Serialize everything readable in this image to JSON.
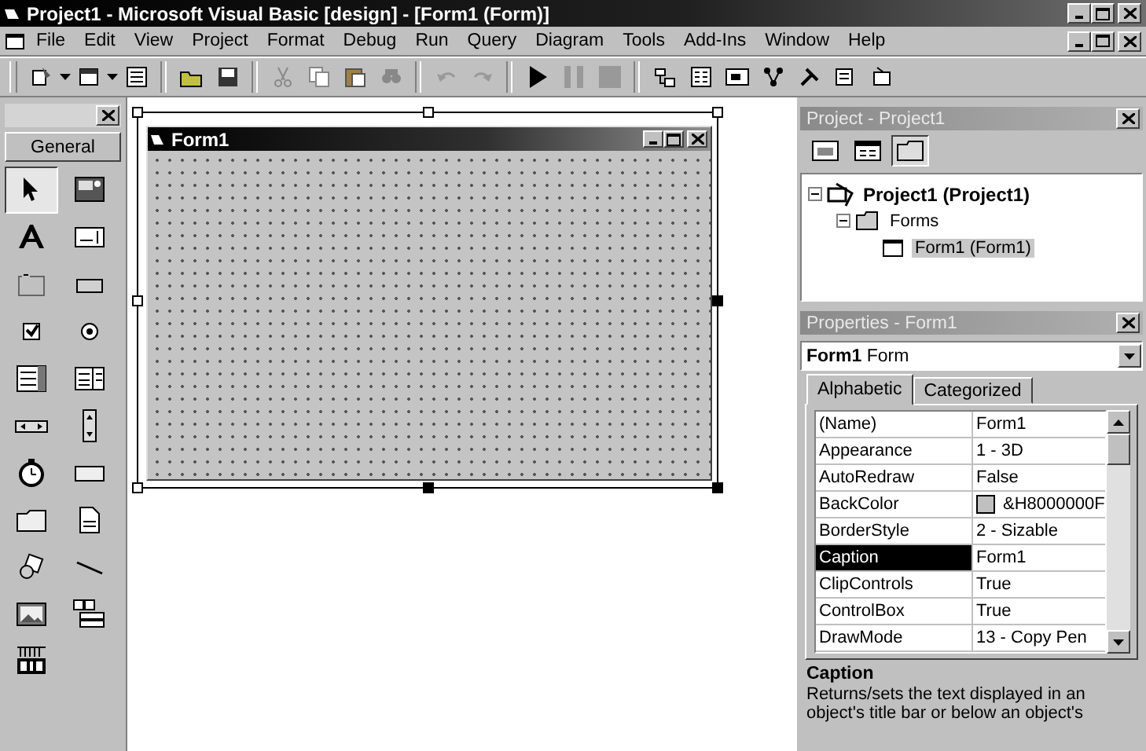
{
  "window": {
    "title": "Project1 - Microsoft Visual Basic [design] - [Form1 (Form)]"
  },
  "menu": [
    {
      "label": "File"
    },
    {
      "label": "Edit"
    },
    {
      "label": "View"
    },
    {
      "label": "Project"
    },
    {
      "label": "Format"
    },
    {
      "label": "Debug"
    },
    {
      "label": "Run"
    },
    {
      "label": "Query"
    },
    {
      "label": "Diagram"
    },
    {
      "label": "Tools"
    },
    {
      "label": "Add-Ins"
    },
    {
      "label": "Window"
    },
    {
      "label": "Help"
    }
  ],
  "toolbox": {
    "tab": "General",
    "tools": [
      {
        "kind": "pointer",
        "selected": true
      },
      {
        "kind": "picturebox",
        "selected": false
      },
      {
        "kind": "label",
        "selected": false
      },
      {
        "kind": "textbox",
        "selected": false
      },
      {
        "kind": "frame",
        "selected": false
      },
      {
        "kind": "commandbutton",
        "selected": false
      },
      {
        "kind": "checkbox",
        "selected": false
      },
      {
        "kind": "optionbutton",
        "selected": false
      },
      {
        "kind": "combobox",
        "selected": false
      },
      {
        "kind": "listbox",
        "selected": false
      },
      {
        "kind": "hscroll",
        "selected": false
      },
      {
        "kind": "vscroll",
        "selected": false
      },
      {
        "kind": "timer",
        "selected": false
      },
      {
        "kind": "drivelist",
        "selected": false
      },
      {
        "kind": "dirlist",
        "selected": false
      },
      {
        "kind": "filelist",
        "selected": false
      },
      {
        "kind": "shape",
        "selected": false
      },
      {
        "kind": "line",
        "selected": false
      },
      {
        "kind": "image",
        "selected": false
      },
      {
        "kind": "data",
        "selected": false
      },
      {
        "kind": "ole",
        "selected": false
      }
    ]
  },
  "form": {
    "title": "Form1"
  },
  "project": {
    "title": "Project - Project1",
    "tree": [
      {
        "label": "Project1 (Project1)",
        "kind": "project",
        "expanded": true,
        "selected": false,
        "children": [
          {
            "label": "Forms",
            "kind": "folder",
            "expanded": true,
            "selected": false,
            "children": [
              {
                "label": "Form1 (Form1)",
                "kind": "form",
                "selected": true
              }
            ]
          }
        ]
      }
    ]
  },
  "properties": {
    "title": "Properties - Form1",
    "object": "**Form1** Form",
    "tabs": [
      {
        "label": "Alphabetic",
        "selected": true
      },
      {
        "label": "Categorized",
        "selected": false
      }
    ],
    "rows": [
      {
        "name": "(Name)",
        "value": "Form1",
        "selected": false
      },
      {
        "name": "Appearance",
        "value": "1 - 3D",
        "selected": false
      },
      {
        "name": "AutoRedraw",
        "value": "False",
        "selected": false
      },
      {
        "name": "BackColor",
        "value": "&H8000000F",
        "selected": false,
        "color": "#c0c0c0"
      },
      {
        "name": "BorderStyle",
        "value": "2 - Sizable",
        "selected": false
      },
      {
        "name": "Caption",
        "value": "Form1",
        "selected": true
      },
      {
        "name": "ClipControls",
        "value": "True",
        "selected": false
      },
      {
        "name": "ControlBox",
        "value": "True",
        "selected": false
      },
      {
        "name": "DrawMode",
        "value": "13 - Copy Pen",
        "selected": false
      }
    ],
    "description": {
      "title": "Caption",
      "text": "Returns/sets the text displayed in an object's title bar or below an object's"
    }
  }
}
